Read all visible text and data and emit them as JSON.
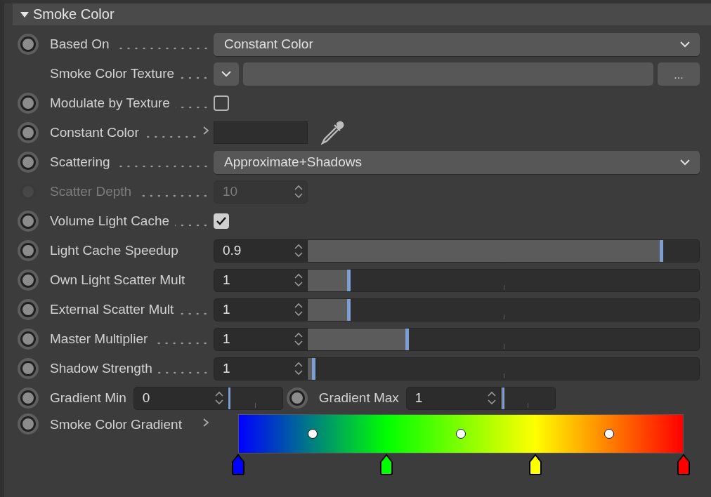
{
  "section": {
    "title": "Smoke Color",
    "expanded": true
  },
  "rows": [
    {
      "kind": "dropdown",
      "label": "Based On",
      "dotted": true,
      "keyframe": true,
      "disabled": false,
      "value": "Constant Color"
    },
    {
      "kind": "texture",
      "label": "Smoke Color Texture",
      "dotted": true,
      "keyframe": false,
      "disabled": false,
      "button": "..."
    },
    {
      "kind": "checkbox",
      "label": "Modulate by Texture",
      "dotted": true,
      "keyframe": true,
      "disabled": false,
      "checked": false
    },
    {
      "kind": "color",
      "label": "Constant Color",
      "dotted": true,
      "keyframe": true,
      "disabled": false,
      "expanded": false
    },
    {
      "kind": "dropdown",
      "label": "Scattering",
      "dotted": true,
      "keyframe": true,
      "disabled": false,
      "value": "Approximate+Shadows"
    },
    {
      "kind": "number",
      "label": "Scatter Depth",
      "dotted": true,
      "keyframe": true,
      "disabled": true,
      "value": "10"
    },
    {
      "kind": "checkbox",
      "label": "Volume Light Cache",
      "dotted": true,
      "keyframe": true,
      "disabled": false,
      "checked": true
    },
    {
      "kind": "slider",
      "label": "Light Cache Speedup",
      "dotted": false,
      "keyframe": true,
      "disabled": false,
      "value": "0.9",
      "level": 0.9
    },
    {
      "kind": "slider",
      "label": "Own Light Scatter Mult",
      "dotted": false,
      "keyframe": true,
      "disabled": false,
      "value": "1",
      "level": 0.1
    },
    {
      "kind": "slider",
      "label": "External Scatter Mult",
      "dotted": true,
      "keyframe": true,
      "disabled": false,
      "value": "1",
      "level": 0.1
    },
    {
      "kind": "slider",
      "label": "Master Multiplier",
      "dotted": true,
      "keyframe": true,
      "disabled": false,
      "value": "1",
      "level": 0.25
    },
    {
      "kind": "slider",
      "label": "Shadow Strength",
      "dotted": true,
      "keyframe": true,
      "disabled": false,
      "value": "1",
      "level": 0.01
    },
    {
      "kind": "pair",
      "fields": [
        {
          "label": "Gradient Min",
          "value": "0",
          "level": 0
        },
        {
          "label": "Gradient Max",
          "value": "1",
          "level": 0.03
        }
      ]
    },
    {
      "kind": "gradient",
      "label": "Smoke Color Gradient",
      "dotted": false,
      "keyframe": true,
      "disabled": false,
      "expanded": false,
      "stops": [
        {
          "color": "#0000ff"
        },
        {
          "color": "#00ff00"
        },
        {
          "color": "#ffff00"
        },
        {
          "color": "#ff0000"
        }
      ]
    }
  ]
}
